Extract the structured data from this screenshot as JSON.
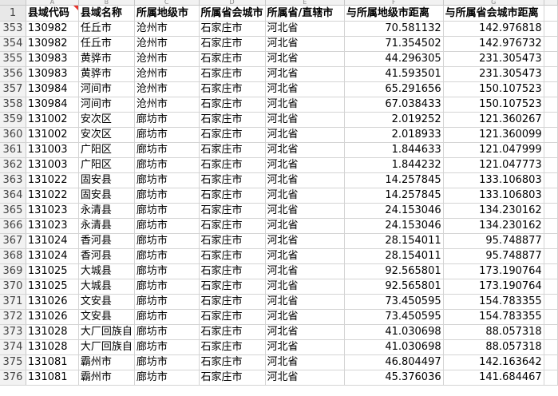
{
  "columns": [
    "A",
    "B",
    "C",
    "D",
    "E",
    "F",
    "G"
  ],
  "header_row": {
    "row_number": "1",
    "cells": [
      "县域代码",
      "县域名称",
      "所属地级市",
      "所属省会城市",
      "所属省/直辖市",
      "与所属地级市距离",
      "与所属省会城市距离"
    ]
  },
  "rows": [
    {
      "n": "353",
      "cells": [
        "130982",
        "任丘市",
        "沧州市",
        "石家庄市",
        "河北省",
        "70.581132",
        "142.976818"
      ]
    },
    {
      "n": "354",
      "cells": [
        "130982",
        "任丘市",
        "沧州市",
        "石家庄市",
        "河北省",
        "71.354502",
        "142.976732"
      ]
    },
    {
      "n": "355",
      "cells": [
        "130983",
        "黄骅市",
        "沧州市",
        "石家庄市",
        "河北省",
        "44.296305",
        "231.305473"
      ]
    },
    {
      "n": "356",
      "cells": [
        "130983",
        "黄骅市",
        "沧州市",
        "石家庄市",
        "河北省",
        "41.593501",
        "231.305473"
      ]
    },
    {
      "n": "357",
      "cells": [
        "130984",
        "河间市",
        "沧州市",
        "石家庄市",
        "河北省",
        "65.291656",
        "150.107523"
      ]
    },
    {
      "n": "358",
      "cells": [
        "130984",
        "河间市",
        "沧州市",
        "石家庄市",
        "河北省",
        "67.038433",
        "150.107523"
      ]
    },
    {
      "n": "359",
      "cells": [
        "131002",
        "安次区",
        "廊坊市",
        "石家庄市",
        "河北省",
        "2.019252",
        "121.360267"
      ]
    },
    {
      "n": "360",
      "cells": [
        "131002",
        "安次区",
        "廊坊市",
        "石家庄市",
        "河北省",
        "2.018933",
        "121.360099"
      ]
    },
    {
      "n": "361",
      "cells": [
        "131003",
        "广阳区",
        "廊坊市",
        "石家庄市",
        "河北省",
        "1.844633",
        "121.047999"
      ]
    },
    {
      "n": "362",
      "cells": [
        "131003",
        "广阳区",
        "廊坊市",
        "石家庄市",
        "河北省",
        "1.844232",
        "121.047773"
      ]
    },
    {
      "n": "363",
      "cells": [
        "131022",
        "固安县",
        "廊坊市",
        "石家庄市",
        "河北省",
        "14.257845",
        "133.106803"
      ]
    },
    {
      "n": "364",
      "cells": [
        "131022",
        "固安县",
        "廊坊市",
        "石家庄市",
        "河北省",
        "14.257845",
        "133.106803"
      ]
    },
    {
      "n": "365",
      "cells": [
        "131023",
        "永清县",
        "廊坊市",
        "石家庄市",
        "河北省",
        "24.153046",
        "134.230162"
      ]
    },
    {
      "n": "366",
      "cells": [
        "131023",
        "永清县",
        "廊坊市",
        "石家庄市",
        "河北省",
        "24.153046",
        "134.230162"
      ]
    },
    {
      "n": "367",
      "cells": [
        "131024",
        "香河县",
        "廊坊市",
        "石家庄市",
        "河北省",
        "28.154011",
        "95.748877"
      ]
    },
    {
      "n": "368",
      "cells": [
        "131024",
        "香河县",
        "廊坊市",
        "石家庄市",
        "河北省",
        "28.154011",
        "95.748877"
      ]
    },
    {
      "n": "369",
      "cells": [
        "131025",
        "大城县",
        "廊坊市",
        "石家庄市",
        "河北省",
        "92.565801",
        "173.190764"
      ]
    },
    {
      "n": "370",
      "cells": [
        "131025",
        "大城县",
        "廊坊市",
        "石家庄市",
        "河北省",
        "92.565801",
        "173.190764"
      ]
    },
    {
      "n": "371",
      "cells": [
        "131026",
        "文安县",
        "廊坊市",
        "石家庄市",
        "河北省",
        "73.450595",
        "154.783355"
      ]
    },
    {
      "n": "372",
      "cells": [
        "131026",
        "文安县",
        "廊坊市",
        "石家庄市",
        "河北省",
        "73.450595",
        "154.783355"
      ]
    },
    {
      "n": "373",
      "cells": [
        "131028",
        "大厂回族自",
        "廊坊市",
        "石家庄市",
        "河北省",
        "41.030698",
        "88.057318"
      ]
    },
    {
      "n": "374",
      "cells": [
        "131028",
        "大厂回族自",
        "廊坊市",
        "石家庄市",
        "河北省",
        "41.030698",
        "88.057318"
      ]
    },
    {
      "n": "375",
      "cells": [
        "131081",
        "霸州市",
        "廊坊市",
        "石家庄市",
        "河北省",
        "46.804497",
        "142.163642"
      ]
    },
    {
      "n": "376",
      "cells": [
        "131081",
        "霸州市",
        "廊坊市",
        "石家庄市",
        "河北省",
        "45.376036",
        "141.684467"
      ]
    }
  ]
}
